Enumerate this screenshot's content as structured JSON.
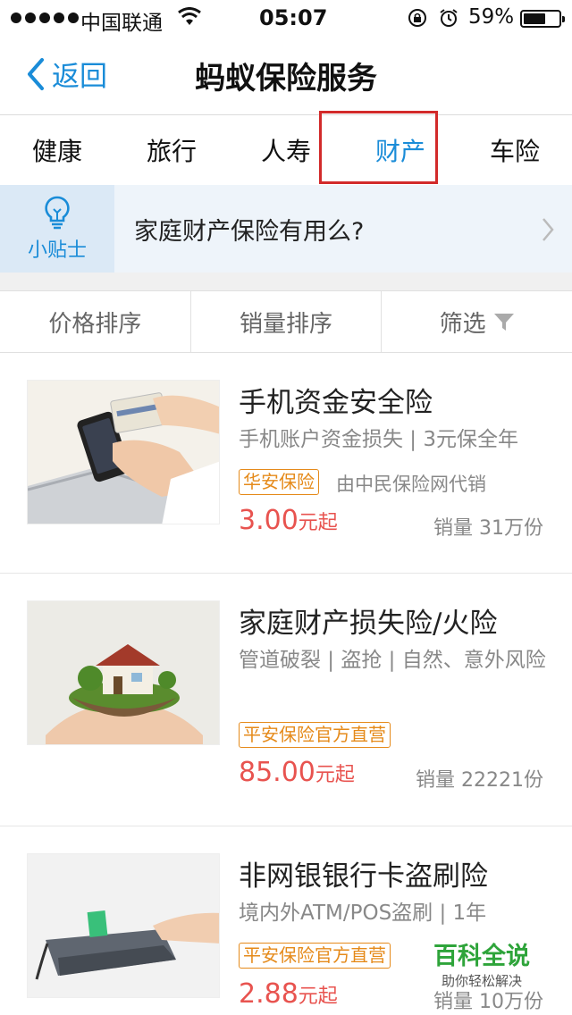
{
  "status_bar": {
    "carrier": "中国联通",
    "time": "05:07",
    "battery": "59%",
    "battery_level": 0.59
  },
  "nav": {
    "back_label": "返回",
    "title": "蚂蚁保险服务"
  },
  "tabs": [
    {
      "label": "健康",
      "active": false
    },
    {
      "label": "旅行",
      "active": false
    },
    {
      "label": "人寿",
      "active": false
    },
    {
      "label": "财产",
      "active": true
    },
    {
      "label": "车险",
      "active": false
    }
  ],
  "tip": {
    "label": "小贴士",
    "text": "家庭财产保险有用么?"
  },
  "sort_bar": {
    "price_sort": "价格排序",
    "sales_sort": "销量排序",
    "filter": "筛选"
  },
  "products": [
    {
      "title": "手机资金安全险",
      "desc": "手机账户资金损失 | 3元保全年",
      "badge": "华安保险",
      "agent": "由中民保险网代销",
      "price": "3.00",
      "price_unit": "元起",
      "sales": "销量 31万份",
      "image": "hands-credit-card-phone-image"
    },
    {
      "title": "家庭财产损失险/火险",
      "desc": "管道破裂 | 盗抢 | 自然、意外风险",
      "badge": "平安保险官方直营",
      "agent": "",
      "price": "85.00",
      "price_unit": "元起",
      "sales": "销量 22221份",
      "image": "house-in-hands-image"
    },
    {
      "title": "非网银银行卡盗刷险",
      "desc": "境内外ATM/POS盗刷 | 1年",
      "badge": "平安保险官方直营",
      "agent": "",
      "price": "2.88",
      "price_unit": "元起",
      "sales": "销量 10万份",
      "image": "pos-terminal-card-image"
    }
  ],
  "watermark": {
    "title": "百科全说",
    "subtitle": "助你轻松解决"
  },
  "colors": {
    "accent": "#1a8cd8",
    "price": "#e8534f",
    "badge": "#e58a1a",
    "highlight": "#d22a2a"
  }
}
